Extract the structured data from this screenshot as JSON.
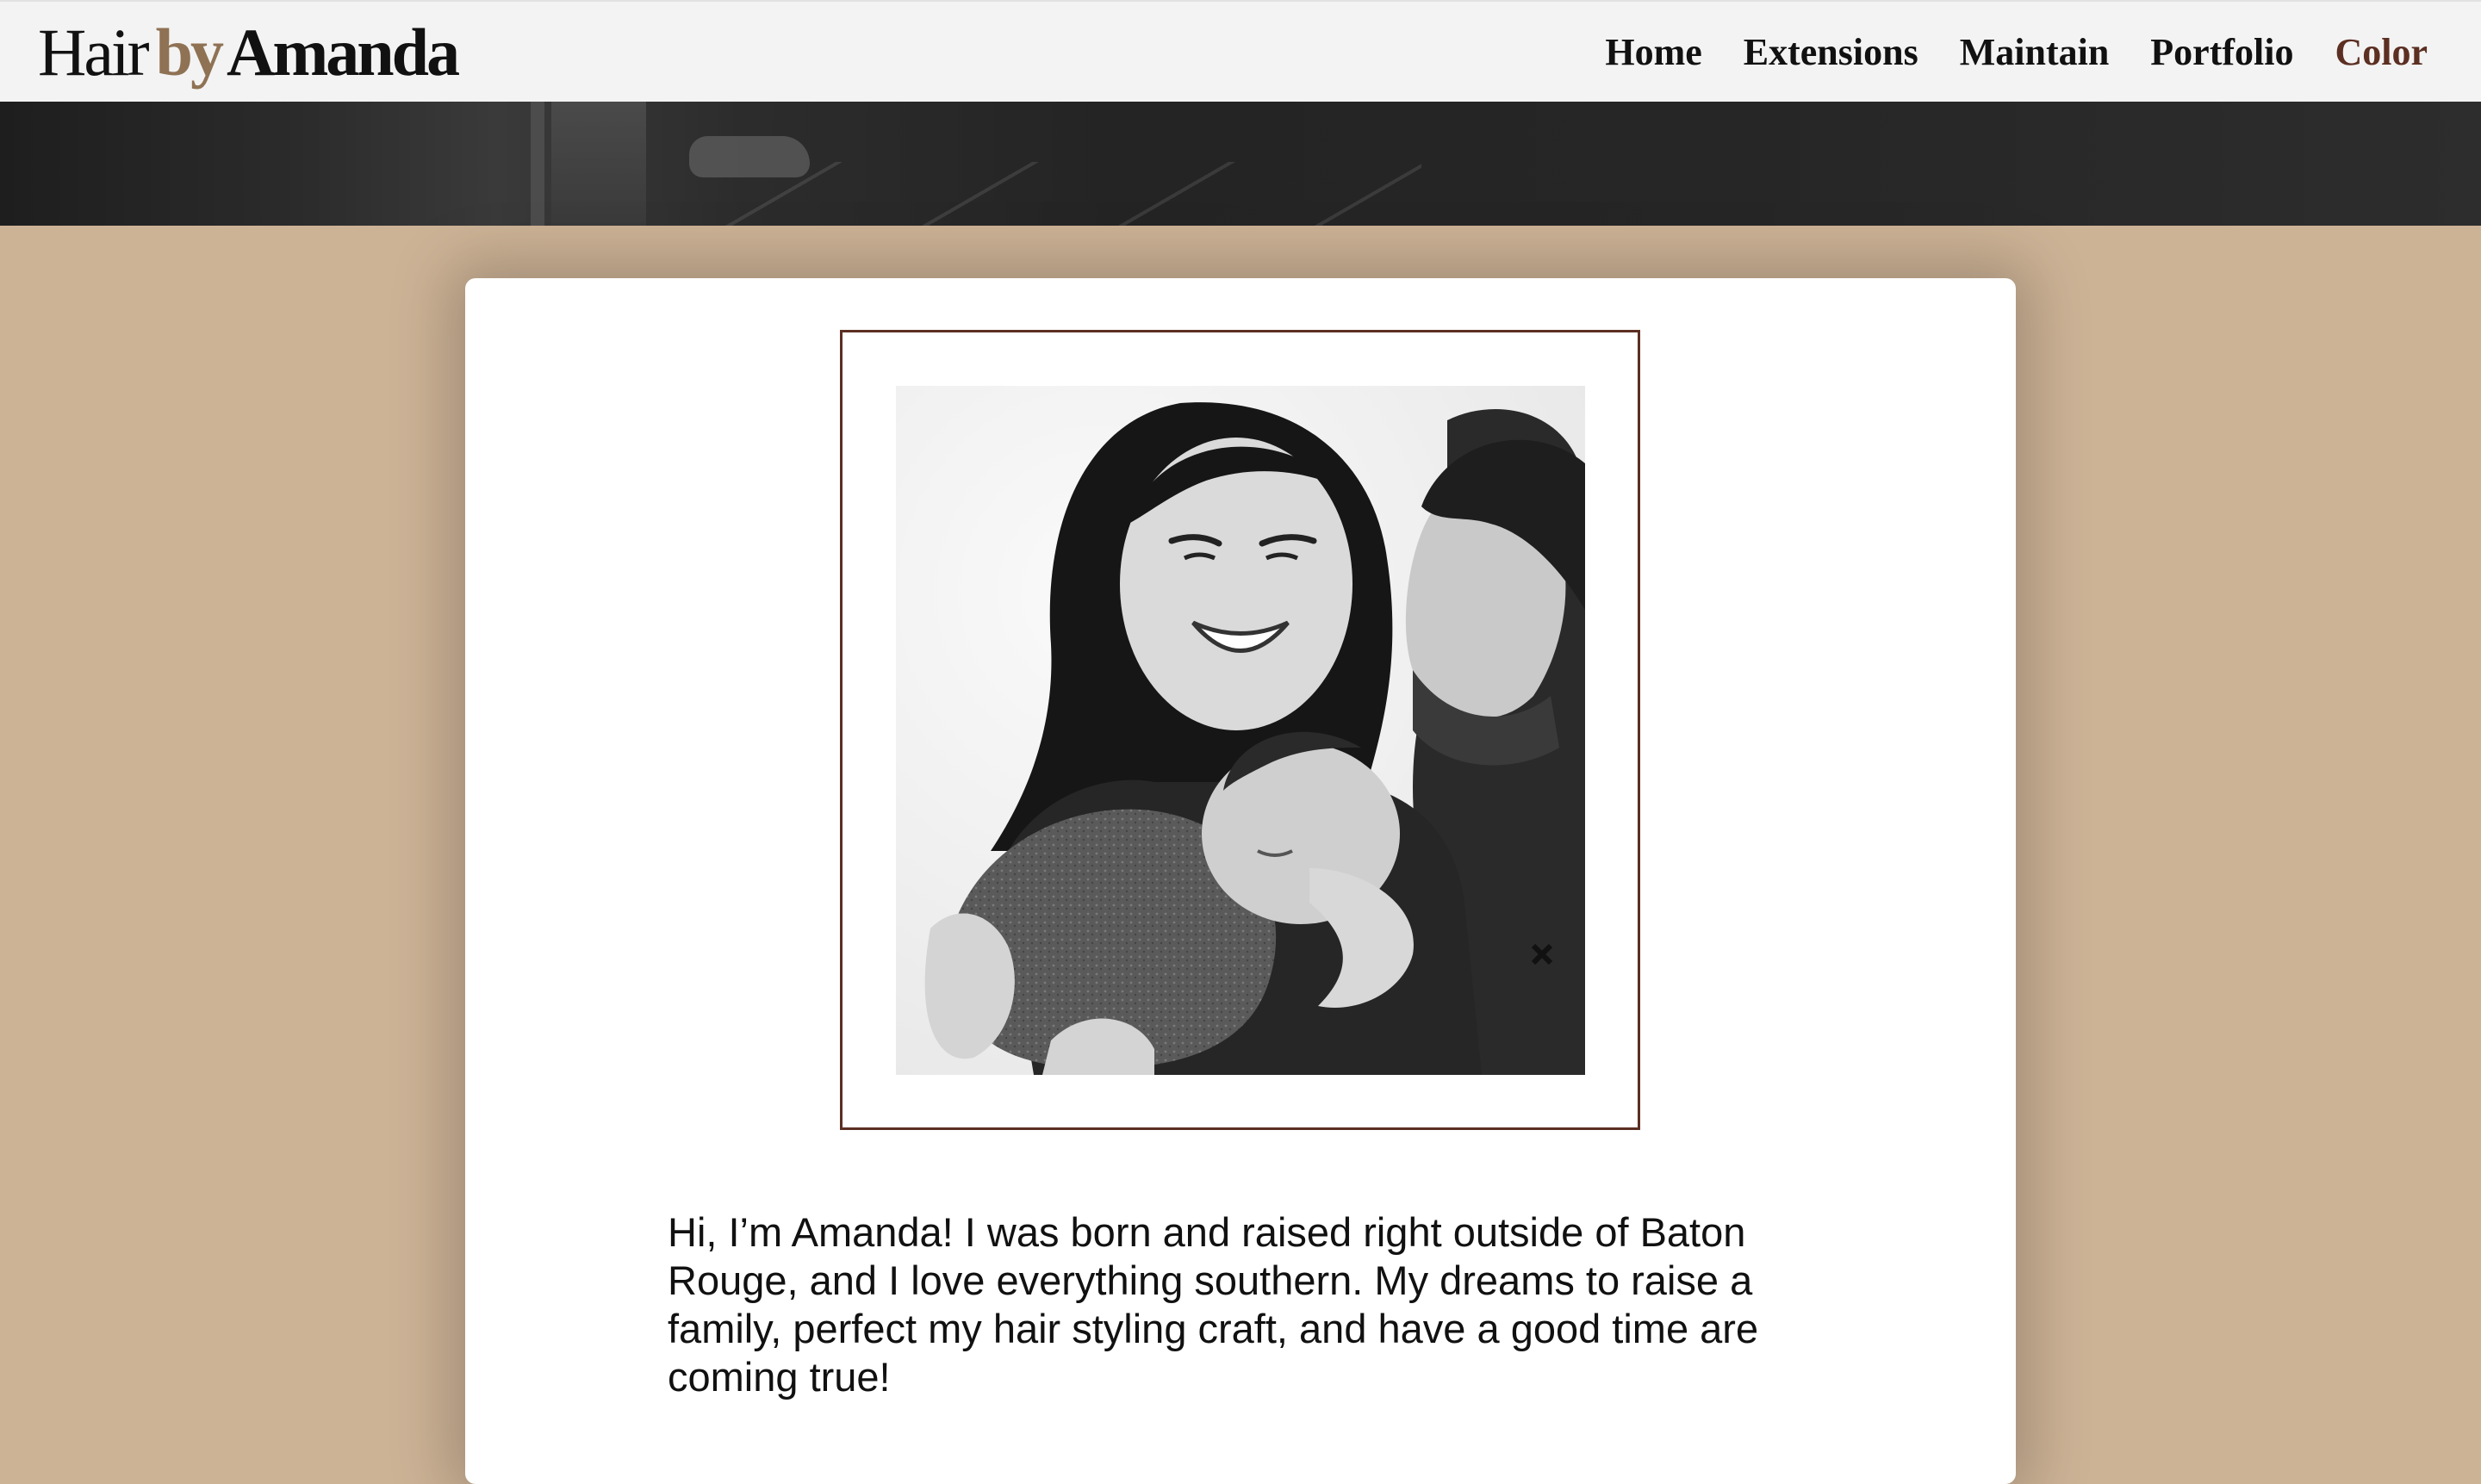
{
  "header": {
    "logo": {
      "part1": "Hair",
      "part2": "by",
      "part3": "Amanda"
    },
    "nav": [
      {
        "label": "Home"
      },
      {
        "label": "Extensions"
      },
      {
        "label": "Maintain"
      },
      {
        "label": "Portfolio"
      },
      {
        "label": "Color"
      }
    ],
    "active_nav": "Color"
  },
  "colors": {
    "page_background": "#cdb396",
    "accent_brown": "#8f7254",
    "active_link": "#5b2f22",
    "frame_border": "#5b2f22"
  },
  "about": {
    "photo_alt": "family-photo",
    "bio": "Hi, I’m Amanda! I was born and raised right outside of Baton Rouge, and I love everything southern. My dreams to raise a family, perfect my hair styling craft, and have a good time are coming true!"
  }
}
